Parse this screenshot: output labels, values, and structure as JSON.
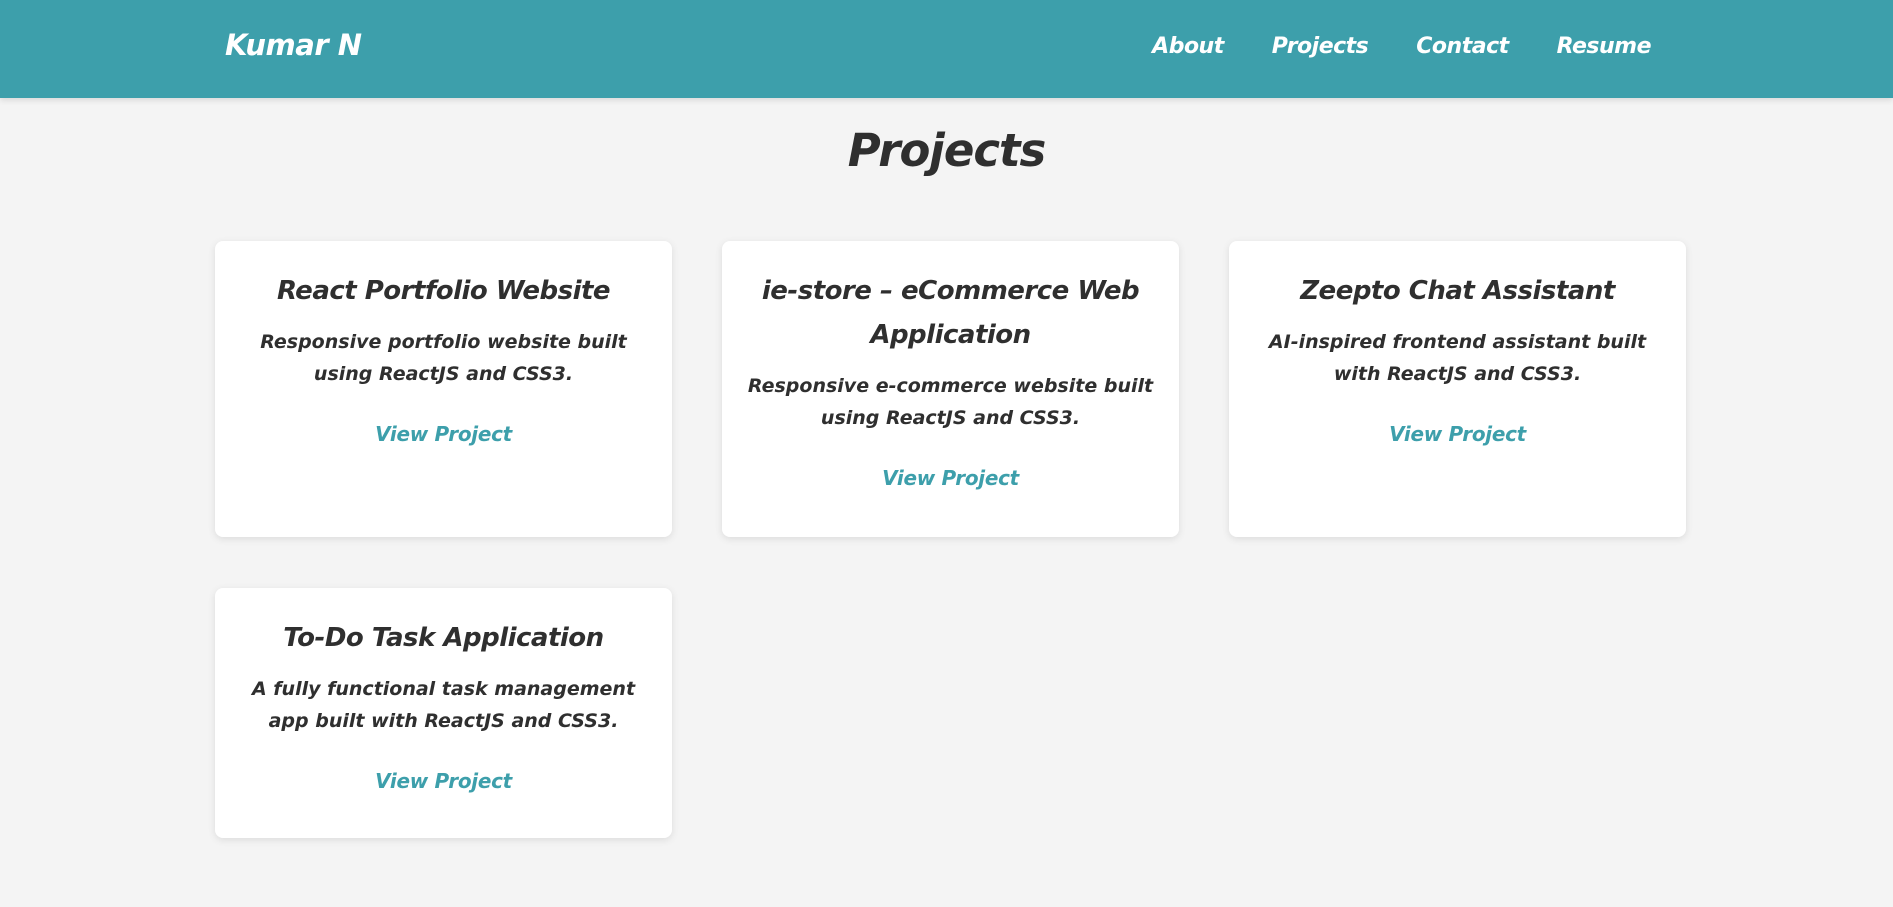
{
  "header": {
    "brand": "Kumar N",
    "nav": [
      {
        "label": "About"
      },
      {
        "label": "Projects"
      },
      {
        "label": "Contact"
      },
      {
        "label": "Resume"
      }
    ]
  },
  "main": {
    "title": "Projects",
    "projects": [
      {
        "title": "React Portfolio Website",
        "description": "Responsive portfolio website built using ReactJS and CSS3.",
        "link_label": "View Project"
      },
      {
        "title": "ie-store – eCommerce Web Application",
        "description": "Responsive e-commerce website built using ReactJS and CSS3.",
        "link_label": "View Project"
      },
      {
        "title": "Zeepto Chat Assistant",
        "description": "AI-inspired frontend assistant built with ReactJS and CSS3.",
        "link_label": "View Project"
      },
      {
        "title": "To-Do Task Application",
        "description": "A fully functional task management app built with ReactJS and CSS3.",
        "link_label": "View Project"
      }
    ]
  },
  "colors": {
    "accent": "#3d9fab",
    "background": "#f4f4f4",
    "card": "#ffffff",
    "text": "#2f2f2f"
  }
}
